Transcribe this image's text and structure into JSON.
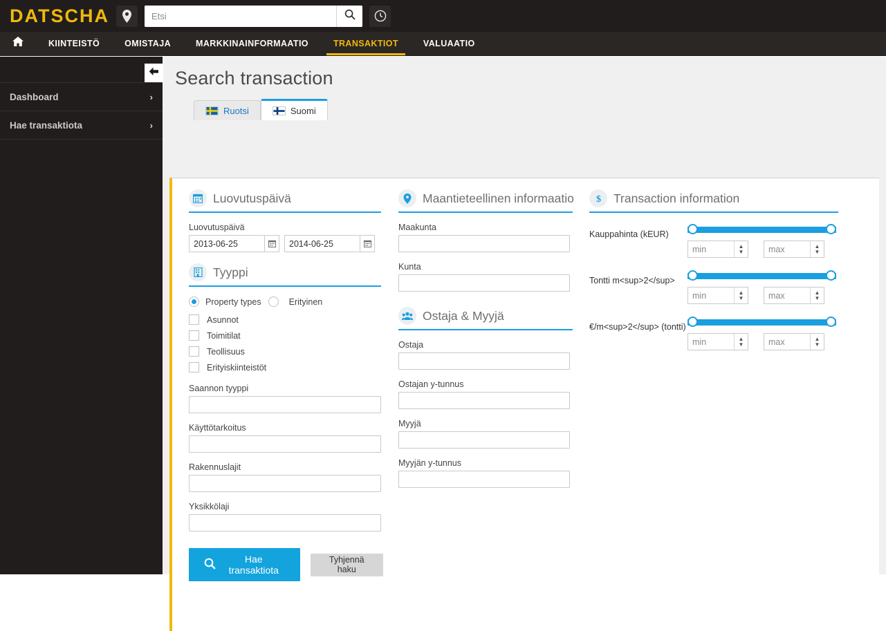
{
  "topbar": {
    "logo": "DATSCHA",
    "map_icon": "map-pin-icon",
    "search_placeholder": "Etsi",
    "search_value": "",
    "search_icon": "search-icon",
    "history_icon": "clock-icon"
  },
  "nav": {
    "home_icon": "home-icon",
    "items": [
      {
        "label": "KIINTEISTÖ",
        "active": false
      },
      {
        "label": "OMISTAJA",
        "active": false
      },
      {
        "label": "MARKKINAINFORMAATIO",
        "active": false
      },
      {
        "label": "TRANSAKTIOT",
        "active": true
      },
      {
        "label": "VALUAATIO",
        "active": false
      }
    ]
  },
  "sidebar": {
    "collapse_icon": "arrow-left-icon",
    "items": [
      {
        "label": "Dashboard",
        "chevron": "›"
      },
      {
        "label": "Hae transaktiota",
        "chevron": "›"
      }
    ]
  },
  "page": {
    "title": "Search transaction"
  },
  "tabs": [
    {
      "label": "Ruotsi",
      "flag": "sweden-flag-icon",
      "active": false
    },
    {
      "label": "Suomi",
      "flag": "finland-flag-icon",
      "active": true
    }
  ],
  "sections": {
    "date": {
      "title": "Luovutuspäivä",
      "icon": "calendar-icon",
      "field_label": "Luovutuspäivä",
      "from_value": "2013-06-25",
      "to_value": "2014-06-25",
      "calendar_button_icon": "calendar-icon"
    },
    "type": {
      "title": "Tyyppi",
      "icon": "building-icon",
      "radios": [
        {
          "label": "Property types",
          "checked": true
        },
        {
          "label": "Erityinen",
          "checked": false
        }
      ],
      "checkboxes": [
        {
          "label": "Asunnot",
          "checked": false
        },
        {
          "label": "Toimitilat",
          "checked": false
        },
        {
          "label": "Teollisuus",
          "checked": false
        },
        {
          "label": "Erityiskiinteistöt",
          "checked": false
        }
      ],
      "fields": [
        {
          "label": "Saannon tyyppi",
          "value": ""
        },
        {
          "label": "Käyttötarkoitus",
          "value": ""
        },
        {
          "label": "Rakennuslajit",
          "value": ""
        },
        {
          "label": "Yksikkölaji",
          "value": ""
        }
      ]
    },
    "geo": {
      "title": "Maantieteellinen informaatio",
      "icon": "map-pin-icon",
      "fields": [
        {
          "label": "Maakunta",
          "value": ""
        },
        {
          "label": "Kunta",
          "value": ""
        }
      ]
    },
    "parties": {
      "title": "Ostaja & Myyjä",
      "icon": "users-icon",
      "fields": [
        {
          "label": "Ostaja",
          "value": ""
        },
        {
          "label": "Ostajan y-tunnus",
          "value": ""
        },
        {
          "label": "Myyjä",
          "value": ""
        },
        {
          "label": "Myyjän y-tunnus",
          "value": ""
        }
      ]
    },
    "transaction": {
      "title": "Transaction information",
      "icon": "dollar-icon",
      "sliders": [
        {
          "label": "Kauppahinta (kEUR)",
          "min_placeholder": "min",
          "max_placeholder": "max",
          "min_value": "",
          "max_value": ""
        },
        {
          "label": "Tontti m<sup>2</sup>",
          "min_placeholder": "min",
          "max_placeholder": "max",
          "min_value": "",
          "max_value": ""
        },
        {
          "label": "€/m<sup>2</sup> (tontti)",
          "min_placeholder": "min",
          "max_placeholder": "max",
          "min_value": "",
          "max_value": ""
        }
      ]
    }
  },
  "buttons": {
    "search": "Hae transaktiota",
    "search_icon": "search-icon",
    "clear": "Tyhjennä haku"
  },
  "colors": {
    "brand_yellow": "#f0b90b",
    "accent_blue": "#1a9fe0",
    "dark_bar": "#211d1c",
    "nav_bar": "#2b2725",
    "page_bg": "#f0f0f0"
  }
}
